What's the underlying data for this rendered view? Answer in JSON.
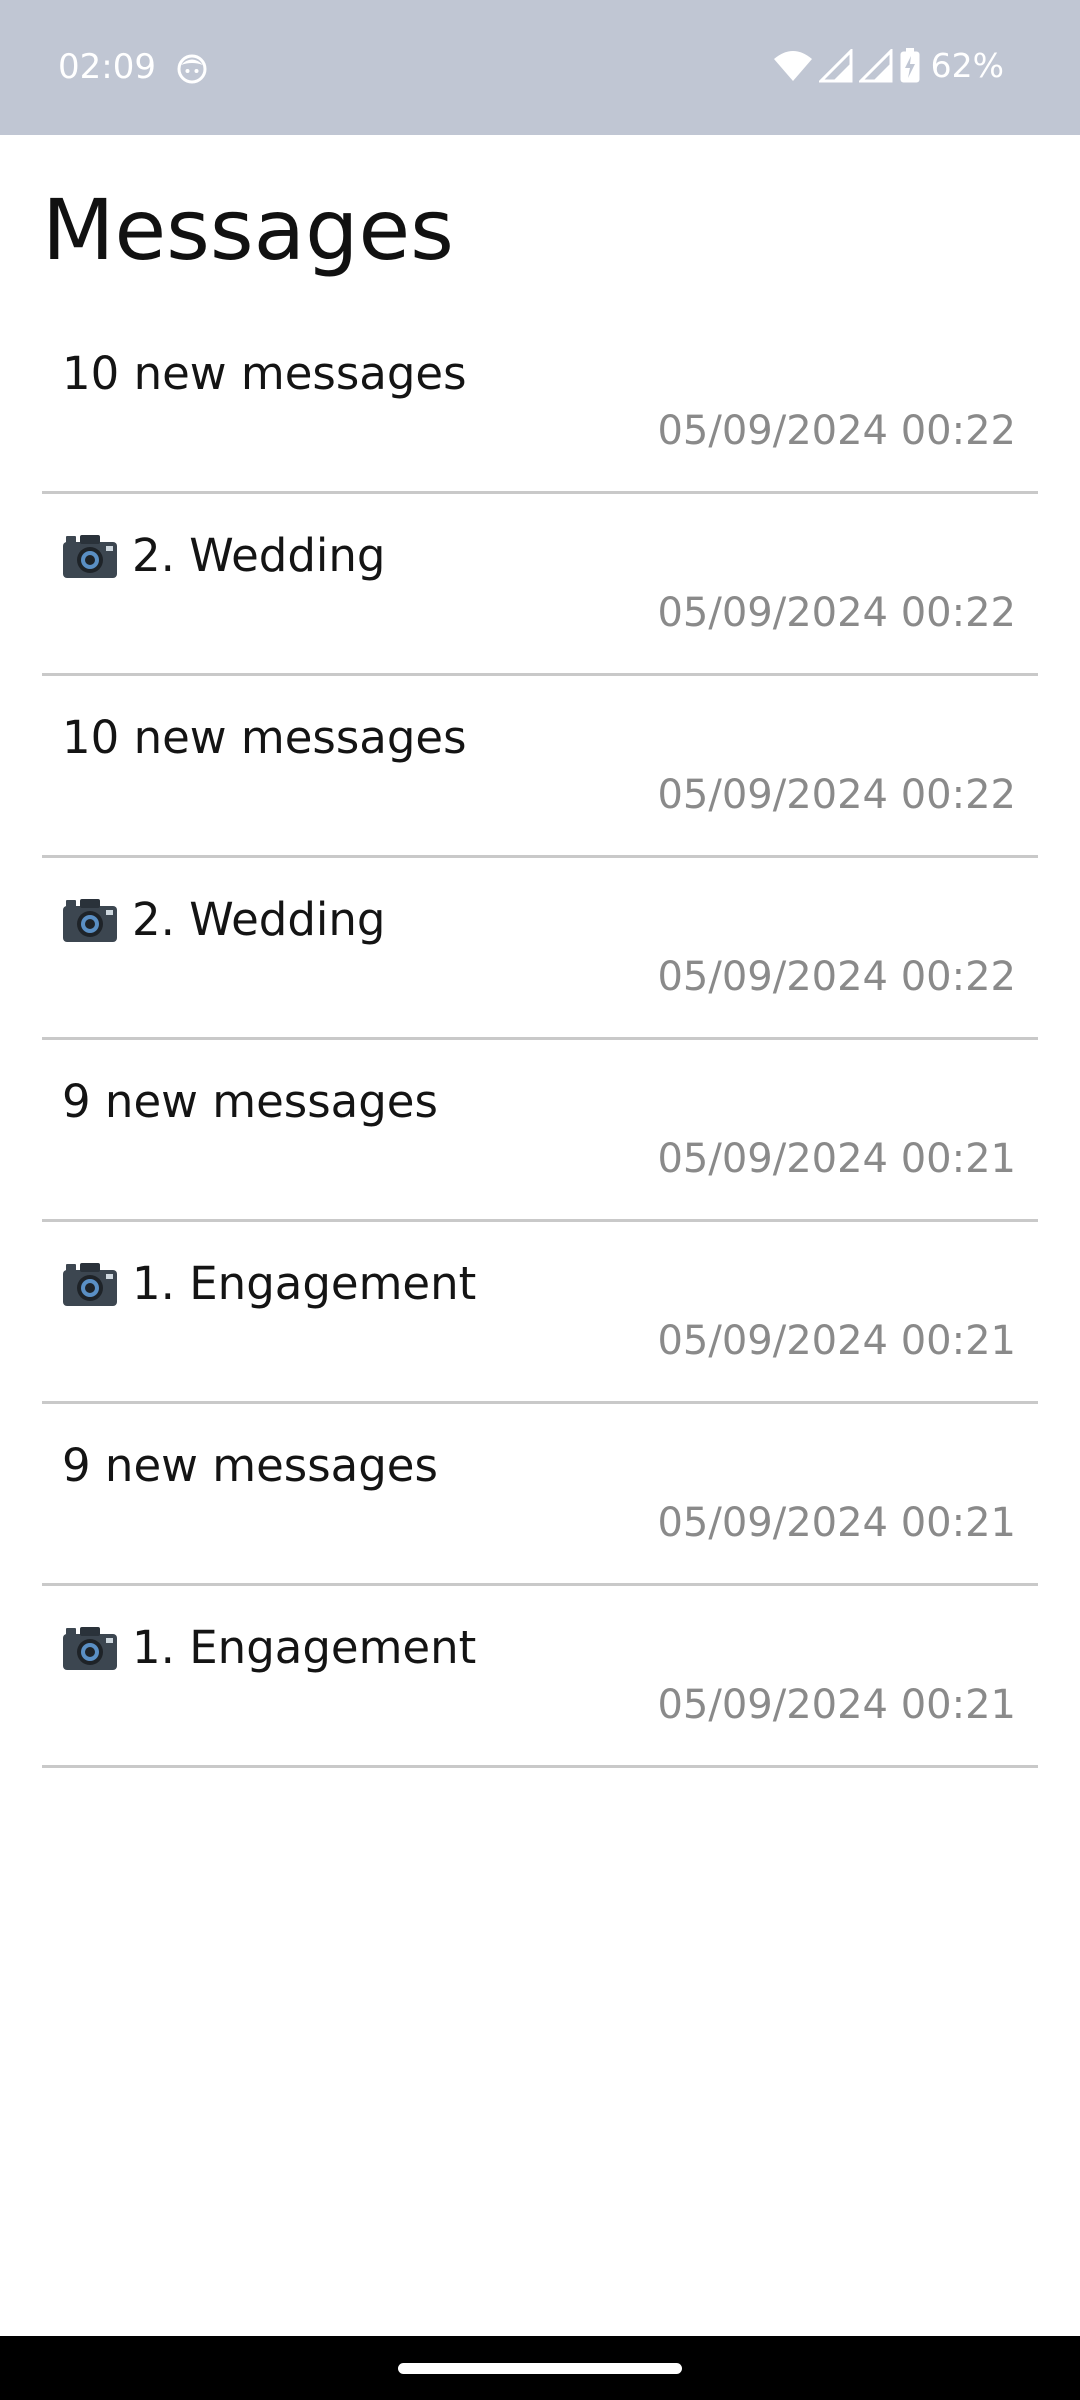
{
  "status_bar": {
    "time": "02:09",
    "battery_percent": "62%",
    "icons": [
      "face-icon",
      "wifi-icon",
      "signal-icon",
      "signal-icon",
      "battery-charging-icon"
    ],
    "background_color": "#c0c6d3"
  },
  "page": {
    "title": "Messages"
  },
  "messages": [
    {
      "text": "10 new messages",
      "timestamp": "05/09/2024 00:22",
      "has_camera_icon": false
    },
    {
      "text": "2. Wedding",
      "timestamp": "05/09/2024 00:22",
      "has_camera_icon": true
    },
    {
      "text": "10 new messages",
      "timestamp": "05/09/2024 00:22",
      "has_camera_icon": false
    },
    {
      "text": "2. Wedding",
      "timestamp": "05/09/2024 00:22",
      "has_camera_icon": true
    },
    {
      "text": "9 new messages",
      "timestamp": "05/09/2024 00:21",
      "has_camera_icon": false
    },
    {
      "text": "1. Engagement",
      "timestamp": "05/09/2024 00:21",
      "has_camera_icon": true
    },
    {
      "text": "9 new messages",
      "timestamp": "05/09/2024 00:21",
      "has_camera_icon": false
    },
    {
      "text": "1. Engagement",
      "timestamp": "05/09/2024 00:21",
      "has_camera_icon": true
    }
  ]
}
